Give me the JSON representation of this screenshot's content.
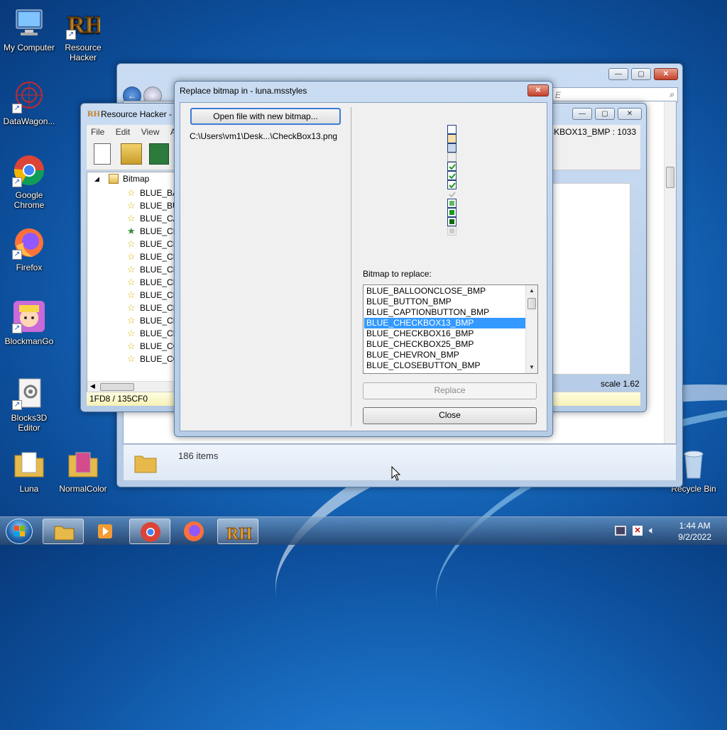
{
  "desktop": {
    "icons": [
      {
        "label": "My Computer"
      },
      {
        "label": "Resource Hacker"
      },
      {
        "label": "DataWagon..."
      },
      {
        "label": "Google Chrome"
      },
      {
        "label": "Firefox"
      },
      {
        "label": "BlockmanGo"
      },
      {
        "label": "Blocks3D Editor"
      },
      {
        "label": "Luna"
      },
      {
        "label": "NormalColor"
      },
      {
        "label": "Recycle Bin"
      }
    ]
  },
  "explorer": {
    "status_items": "186 items",
    "search_placeholder": "E"
  },
  "resource_hacker": {
    "title": "Resource Hacker - l",
    "menu": [
      "File",
      "Edit",
      "View",
      "Ac"
    ],
    "header_right": "CKBOX13_BMP : 1033",
    "tree_root": "Bitmap",
    "tree_items": [
      "BLUE_BA",
      "BLUE_BU",
      "BLUE_CA",
      "BLUE_CH",
      "BLUE_CH",
      "BLUE_CH",
      "BLUE_CH",
      "BLUE_CL",
      "BLUE_CL",
      "BLUE_CL",
      "BLUE_CL",
      "BLUE_CL",
      "BLUE_CO",
      "BLUE_CO"
    ],
    "statusbar": "1FD8 / 135CF0",
    "scale": "scale 1.62"
  },
  "dialog": {
    "title": "Replace bitmap in - luna.msstyles",
    "open_button": "Open file with new bitmap...",
    "file_path": "C:\\Users\\vm1\\Desk...\\CheckBox13.png",
    "list_label": "Bitmap to replace:",
    "list_items": [
      "BLUE_BALLOONCLOSE_BMP",
      "BLUE_BUTTON_BMP",
      "BLUE_CAPTIONBUTTON_BMP",
      "BLUE_CHECKBOX13_BMP",
      "BLUE_CHECKBOX16_BMP",
      "BLUE_CHECKBOX25_BMP",
      "BLUE_CHEVRON_BMP",
      "BLUE_CLOSEBUTTON_BMP"
    ],
    "selected_item": "BLUE_CHECKBOX13_BMP",
    "replace_button": "Replace",
    "close_button": "Close"
  },
  "taskbar": {
    "time": "1:44 AM",
    "date": "9/2/2022"
  },
  "colors": {
    "selection": "#3399ff",
    "desktop": "#1a6fc4"
  }
}
